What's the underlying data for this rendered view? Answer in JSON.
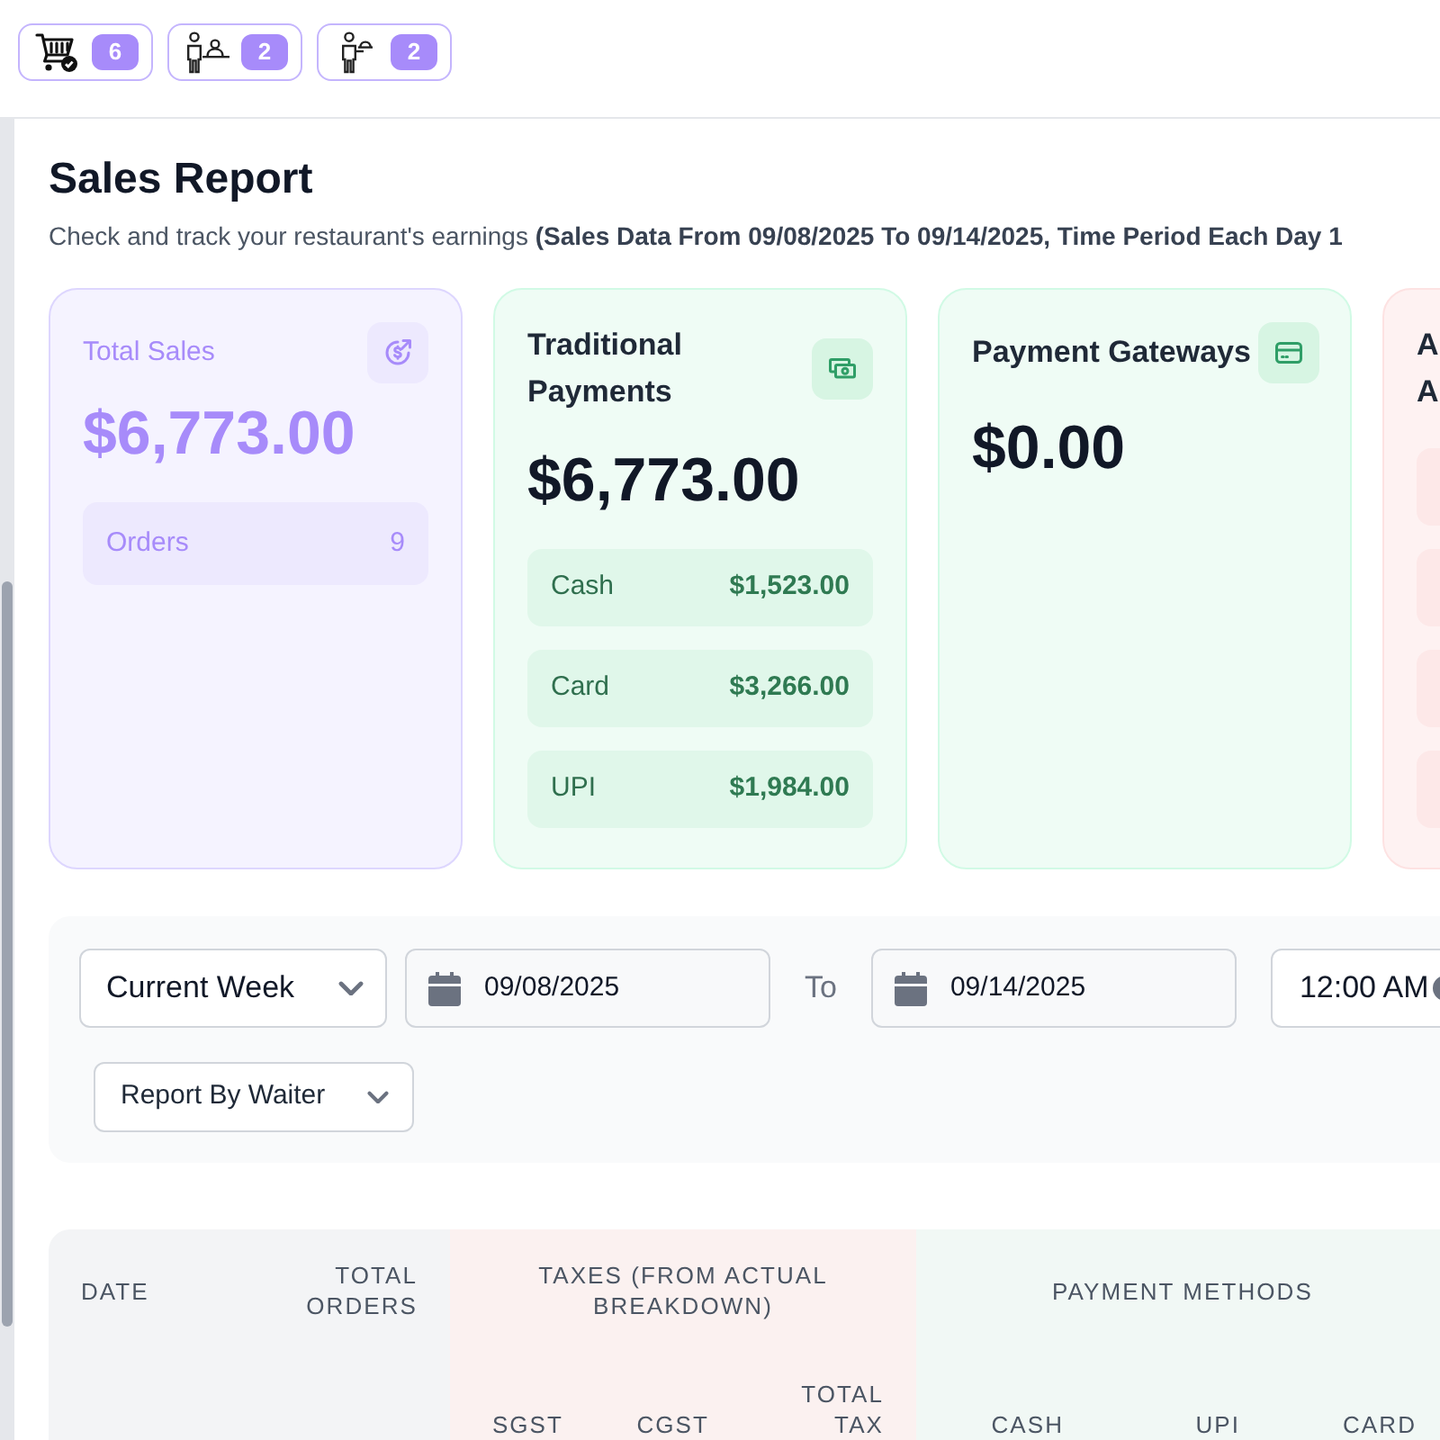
{
  "toolbar": {
    "buttons": [
      {
        "kind": "cart",
        "count": "6"
      },
      {
        "kind": "staff",
        "count": "2"
      },
      {
        "kind": "waiter",
        "count": "2"
      }
    ]
  },
  "header": {
    "title": "Sales Report",
    "subtitle": "Check and track your restaurant's earnings **(Sales Data From 09/08/2025 To 09/14/2025, Time Period Each Day 1**"
  },
  "cards": [
    {
      "kind": "total",
      "title": "Total Sales",
      "amount": "$6,773.00",
      "rows": [
        {
          "label": "Orders",
          "value": "9"
        }
      ]
    },
    {
      "kind": "traditional",
      "title": "Traditional Payments",
      "amount": "$6,773.00",
      "rows": [
        {
          "label": "Cash",
          "value": "$1,523.00"
        },
        {
          "label": "Card",
          "value": "$3,266.00"
        },
        {
          "label": "UPI",
          "value": "$1,984.00"
        }
      ]
    },
    {
      "kind": "gateway",
      "title": "Payment Gateways",
      "amount": "$0.00"
    },
    {
      "kind": "cut",
      "title": "A A",
      "rows": [
        {},
        {},
        {},
        {}
      ]
    }
  ],
  "filters": {
    "period": "Current Week",
    "date_from": "09/08/2025",
    "separator": "To",
    "date_to": "09/14/2025",
    "time_from": "12:00 AM",
    "report_by": "Report By Waiter"
  },
  "table": {
    "header": [
      {
        "kind": "date",
        "label": "DATE"
      },
      {
        "kind": "count",
        "label": "TOTAL ORDERS"
      },
      {
        "kind": "taxes",
        "label": "TAXES (FROM ACTUAL BREAKDOWN)",
        "columns": [
          "SGST",
          "CGST",
          "TOTAL TAX"
        ]
      },
      {
        "kind": "payments",
        "label": "PAYMENT METHODS",
        "columns": [
          "CASH",
          "UPI",
          "CARD"
        ]
      }
    ]
  }
}
